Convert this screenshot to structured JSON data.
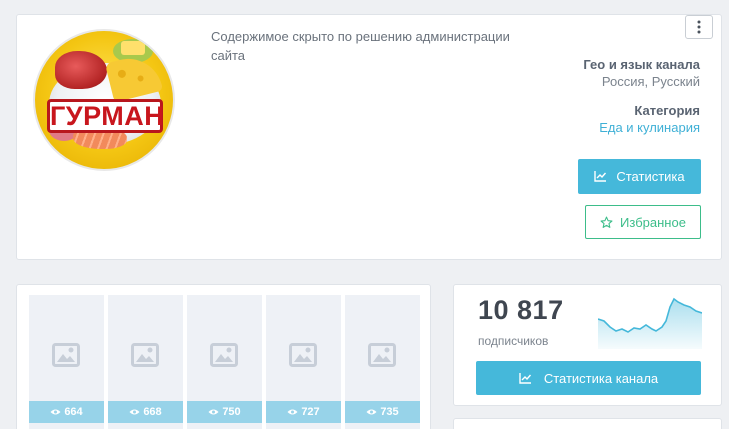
{
  "channel": {
    "logo_text": "ГУРМАН",
    "hidden_message": "Содержимое скрыто по решению администрации сайта",
    "geo_label": "Гео и язык канала",
    "geo_value": "Россия, Русский",
    "category_label": "Категория",
    "category_value": "Еда и кулинария",
    "stats_button": "Статистика",
    "favorite_button": "Избранное"
  },
  "posts": [
    {
      "views": "664"
    },
    {
      "views": "668"
    },
    {
      "views": "750"
    },
    {
      "views": "727"
    },
    {
      "views": "735"
    }
  ],
  "subscribers": {
    "count": "10 817",
    "label": "подписчиков",
    "button": "Статистика канала"
  },
  "colors": {
    "accent_blue": "#45b8da",
    "favorite_green": "#3dbd8a",
    "link_blue": "#3fb0d6"
  },
  "icons": {
    "menu": "vertical-dots-icon",
    "stats": "chart-line-icon",
    "favorite": "star-outline-icon",
    "image_placeholder": "image-icon",
    "views": "eye-icon"
  }
}
